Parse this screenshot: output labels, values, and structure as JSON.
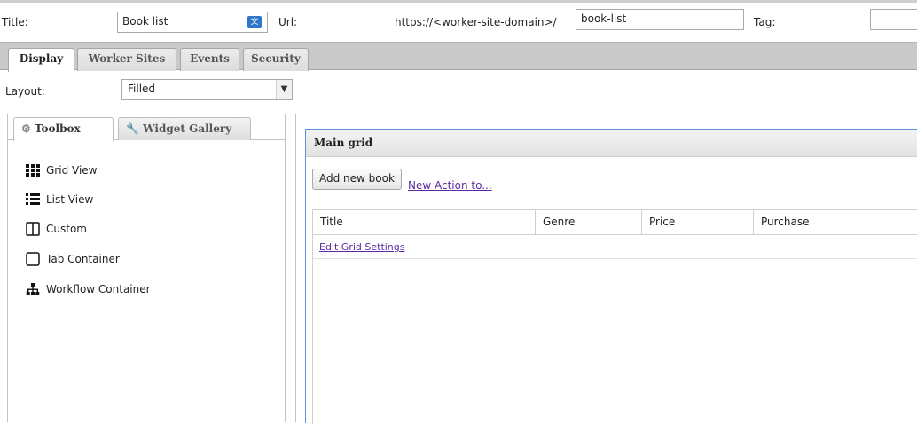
{
  "header": {
    "title_label": "Title:",
    "title_value": "Book list",
    "url_label": "Url:",
    "url_prefix": "https://<worker-site-domain>/",
    "url_value": "book-list",
    "tag_label": "Tag:",
    "tag_value": ""
  },
  "tabs": [
    {
      "label": "Display",
      "active": true
    },
    {
      "label": "Worker Sites",
      "active": false
    },
    {
      "label": "Events",
      "active": false
    },
    {
      "label": "Security",
      "active": false
    }
  ],
  "layout": {
    "label": "Layout:",
    "selected": "Filled"
  },
  "toolbox": {
    "tabs": [
      {
        "label": "Toolbox",
        "icon": "gear-icon",
        "active": true
      },
      {
        "label": "Widget Gallery",
        "icon": "wrench-icon",
        "active": false
      }
    ],
    "items": [
      {
        "label": "Grid View",
        "icon": "grid-icon"
      },
      {
        "label": "List View",
        "icon": "list-icon"
      },
      {
        "label": "Custom",
        "icon": "columns-icon"
      },
      {
        "label": "Tab Container",
        "icon": "square-icon"
      },
      {
        "label": "Workflow Container",
        "icon": "sitemap-icon"
      }
    ]
  },
  "main_grid": {
    "title": "Main grid",
    "add_button": "Add new book",
    "action_link": "New Action to...",
    "columns": [
      "Title",
      "Genre",
      "Price",
      "Purchase"
    ],
    "settings_link": "Edit Grid Settings"
  },
  "colors": {
    "accent_border": "#5d8fd6",
    "link": "#5b2aa3",
    "tabbar": "#c9c9c9"
  }
}
